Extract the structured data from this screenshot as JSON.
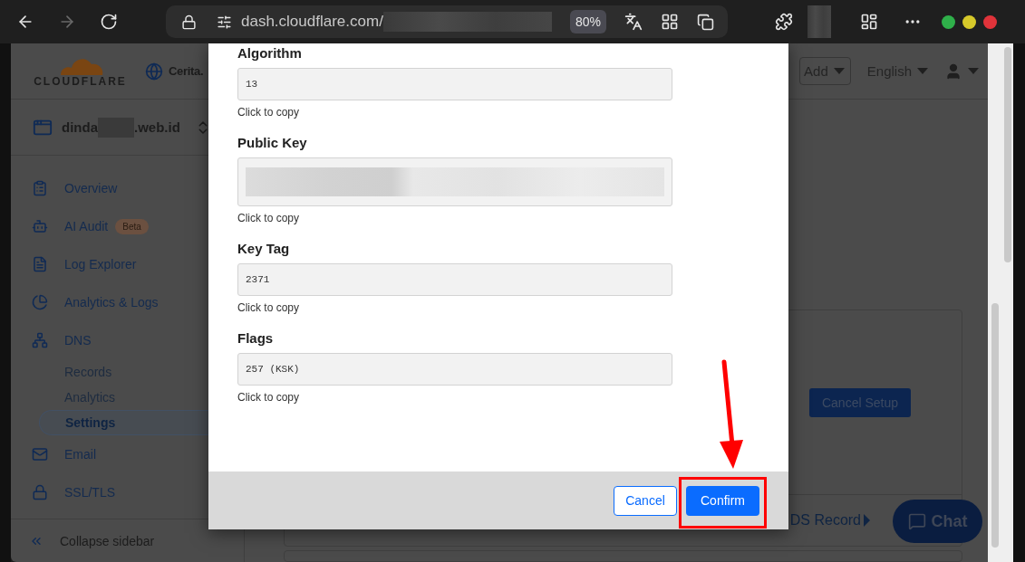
{
  "browser": {
    "url": "dash.cloudflare.com/",
    "zoom": "80%"
  },
  "header": {
    "logo": "CLOUDFLARE",
    "account": "Cerita.",
    "add_button": "Add",
    "language": "English"
  },
  "domain": {
    "prefix": "dinda",
    "suffix": ".web.id"
  },
  "sidebar": {
    "items": [
      {
        "label": "Overview",
        "selected": false
      },
      {
        "label": "AI Audit",
        "badge": "Beta",
        "selected": false
      },
      {
        "label": "Log Explorer",
        "selected": false
      },
      {
        "label": "Analytics & Logs",
        "selected": false
      },
      {
        "label": "DNS",
        "selected": false,
        "children": [
          {
            "label": "Records",
            "selected": false
          },
          {
            "label": "Analytics",
            "selected": false
          },
          {
            "label": "Settings",
            "selected": true
          }
        ]
      },
      {
        "label": "Email",
        "selected": false
      },
      {
        "label": "SSL/TLS",
        "selected": false
      }
    ],
    "collapse": "Collapse sidebar"
  },
  "main": {
    "cancel_setup": "Cancel Setup",
    "ds_record": "DS Record",
    "chat": "Chat"
  },
  "modal": {
    "fields": [
      {
        "kind": "text",
        "label": "Algorithm",
        "value": "13",
        "hint": "Click to copy"
      },
      {
        "kind": "redacted",
        "label": "Public Key",
        "hint": "Click to copy"
      },
      {
        "kind": "text",
        "label": "Key Tag",
        "value": "2371",
        "hint": "Click to copy"
      },
      {
        "kind": "text",
        "label": "Flags",
        "value": "257 (KSK)",
        "hint": "Click to copy"
      }
    ],
    "cancel": "Cancel",
    "confirm": "Confirm"
  }
}
